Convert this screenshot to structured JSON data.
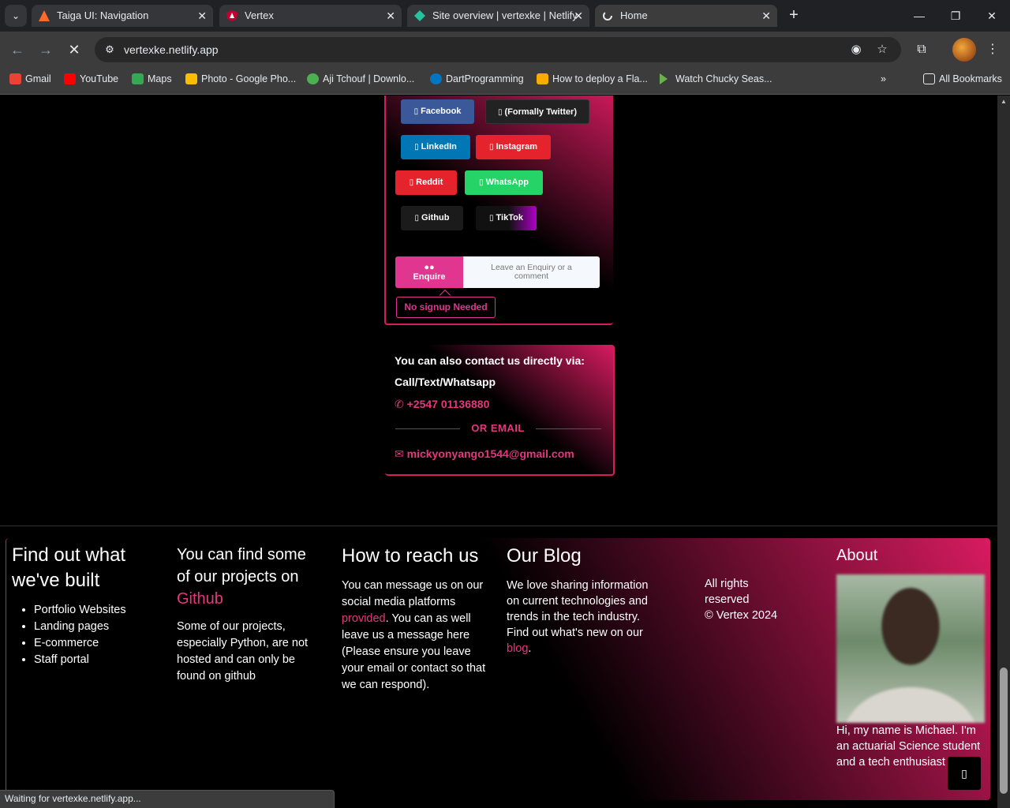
{
  "browser": {
    "tabs": [
      {
        "title": "Taiga UI: Navigation",
        "favicon": "taiga-logo",
        "color": "#ff6a2a"
      },
      {
        "title": "Vertex",
        "favicon": "angular-logo",
        "color": "#c3002f"
      },
      {
        "title": "Site overview | vertexke | Netlify",
        "favicon": "netlify-logo",
        "color": "#25c2a0"
      },
      {
        "title": "Home",
        "favicon": "loading-spinner",
        "color": "#e8eaed"
      }
    ],
    "url": "vertexke.netlify.app",
    "bookmarks": [
      {
        "label": "Gmail",
        "icon": "gmail-icon",
        "color": "#ea4335"
      },
      {
        "label": "YouTube",
        "icon": "youtube-icon",
        "color": "#ff0000"
      },
      {
        "label": "Maps",
        "icon": "maps-icon",
        "color": "#34a853"
      },
      {
        "label": "Photo - Google Pho...",
        "icon": "photos-icon",
        "color": "#fbbc04"
      },
      {
        "label": "Aji Tchouf | Downlo...",
        "icon": "site-icon",
        "color": "#4caf50"
      },
      {
        "label": "DartProgramming",
        "icon": "dart-icon",
        "color": "#0175c2"
      },
      {
        "label": "How to deploy a Fla...",
        "icon": "folder-icon",
        "color": "#f9ab00"
      },
      {
        "label": "Watch Chucky Seas...",
        "icon": "play-icon",
        "color": "#6ab04c"
      }
    ],
    "all_bookmarks": "All Bookmarks",
    "status": "Waiting for vertexke.netlify.app..."
  },
  "social": {
    "buttons": [
      {
        "label": "Facebook",
        "color": "#3b5998"
      },
      {
        "label": "(Formally Twitter)",
        "color": "#222222"
      },
      {
        "label": "LinkedIn",
        "color": "#0077b5"
      },
      {
        "label": "Instagram",
        "color": "#e4232c"
      },
      {
        "label": "Reddit",
        "color": "#e4232c"
      },
      {
        "label": "WhatsApp",
        "color": "#25d366"
      },
      {
        "label": "Github",
        "color": "#1b1b1b"
      },
      {
        "label": "TikTok",
        "color": "#1b1b1b"
      }
    ],
    "glyph": "▯"
  },
  "enquire": {
    "button": "Enquire",
    "hint": "Leave an Enquiry or a comment",
    "badge": "No signup Needed"
  },
  "contact": {
    "heading": "You can also contact us directly via:",
    "sub": "Call/Text/Whatsapp",
    "phone": "+2547 01136880",
    "or_email": "OR EMAIL",
    "email": "mickyonyango1544@gmail.com"
  },
  "footer": {
    "col1": {
      "title": "Find out what we've built",
      "items": [
        "Portfolio Websites",
        "Landing pages",
        "E-commerce",
        "Staff portal"
      ]
    },
    "col2": {
      "title_prefix": "You can find some of our projects on",
      "title_link": "Github",
      "body": "Some of our projects, especially Python, are not hosted and can only be found on github"
    },
    "col3": {
      "title": "How to reach us",
      "body_a": "You can message us on our social media platforms",
      "link": "provided",
      "body_b": ". You can as well leave us a message here (Please ensure you leave your email or contact so that we can respond)."
    },
    "col4": {
      "title": "Our Blog",
      "body": "We love sharing information on current technologies and trends in the tech industry. Find out what's new on our",
      "link": "blog",
      "tail": "."
    },
    "rights": {
      "line1": "All rights",
      "line2": "reserved",
      "copy": "Vertex 2024"
    },
    "about": {
      "title": "About",
      "text": "Hi, my name is Michael. I'm an actuarial Science student and a tech enthusiast"
    }
  }
}
